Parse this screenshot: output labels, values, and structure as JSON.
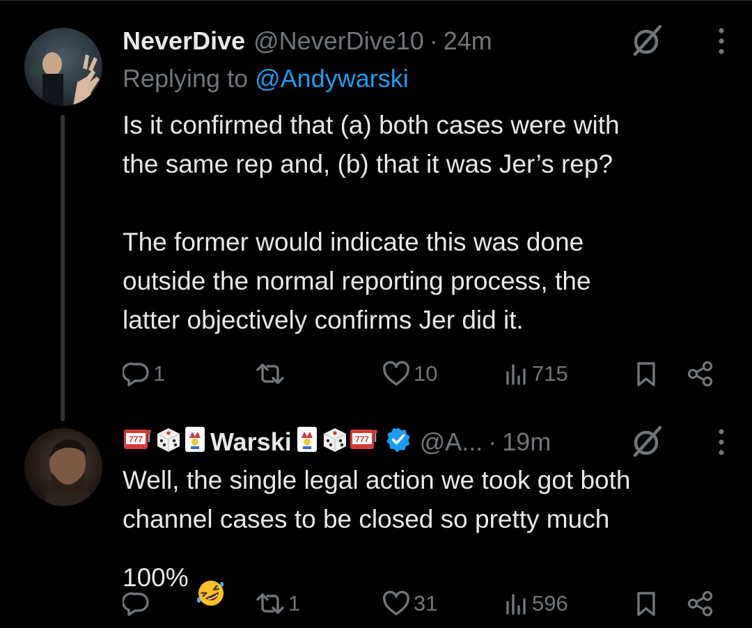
{
  "tweets": [
    {
      "display_name": "NeverDive",
      "handle": "@NeverDive10",
      "separator": "·",
      "time": "24m",
      "reply_prefix": "Replying to",
      "reply_mention": "@Andywarski",
      "paragraphs": [
        "Is it confirmed that (a) both cases were with\nthe same rep and, (b) that it was Jer’s rep?",
        "The former would indicate this was done\noutside the normal reporting process, the\nlatter objectively confirms Jer did it."
      ],
      "metrics": {
        "replies": "1",
        "retweets": "",
        "likes": "10",
        "views": "715"
      },
      "icons": [
        "avatar-photo",
        "grok-icon",
        "more-icon",
        "reply-icon",
        "retweet-icon",
        "like-icon",
        "views-icon",
        "bookmark-icon",
        "share-icon"
      ]
    },
    {
      "display_name": "Warski",
      "name_emoji_left": [
        "slot-machine",
        "game-die",
        "joker-card"
      ],
      "name_emoji_right": [
        "joker-card",
        "game-die",
        "slot-machine"
      ],
      "verified": true,
      "handle": "@A...",
      "separator": "·",
      "time": "19m",
      "body": "Well, the single legal action we took got both\nchannel cases to be closed so pretty much\n100%",
      "body_emoji": "rolling-on-floor-laughing",
      "metrics": {
        "replies": "",
        "retweets": "1",
        "likes": "31",
        "views": "596"
      },
      "icons": [
        "avatar-photo",
        "verified-badge-icon",
        "grok-icon",
        "more-icon",
        "reply-icon",
        "retweet-icon",
        "like-icon",
        "views-icon",
        "bookmark-icon",
        "share-icon"
      ]
    }
  ],
  "colors": {
    "background": "#000000",
    "text_primary": "#e7e9ea",
    "text_secondary": "#71767b",
    "accent": "#1d9bf0",
    "thread_line": "#333639"
  }
}
